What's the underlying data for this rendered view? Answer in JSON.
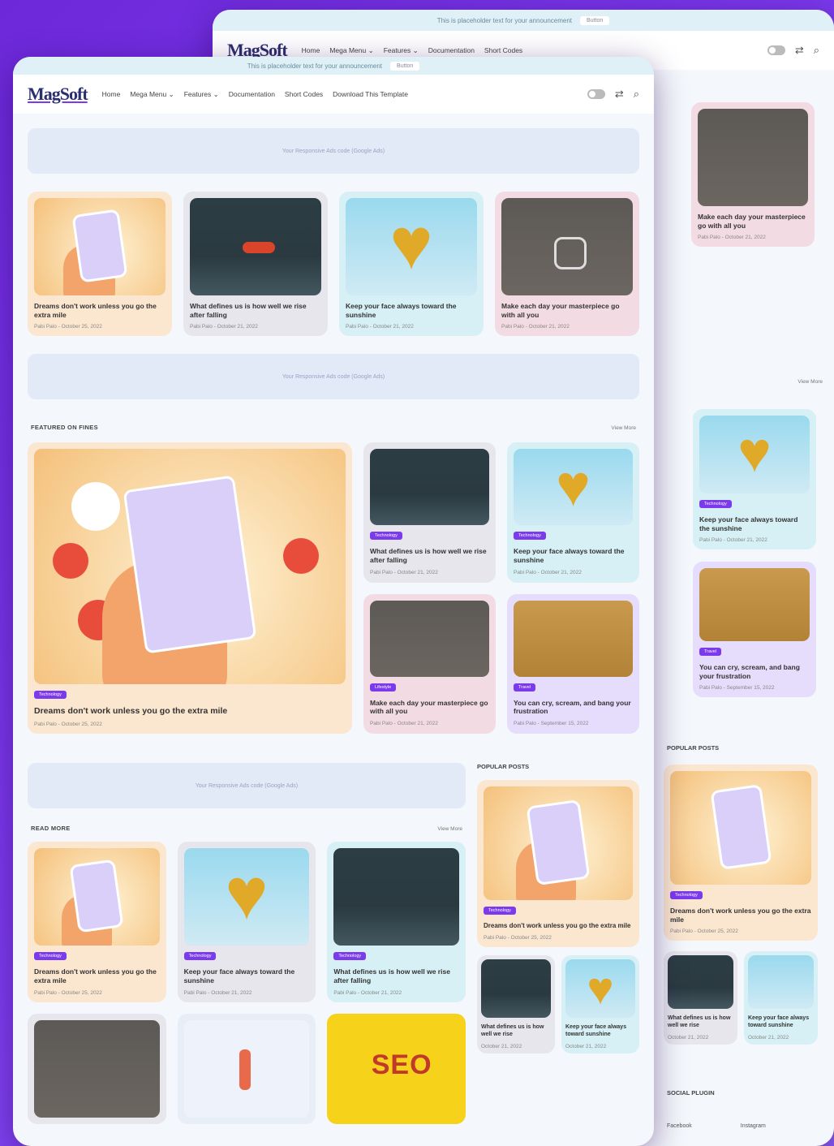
{
  "site": {
    "logo": "MagSoft",
    "topbar_text": "This is placeholder text for your announcement",
    "topbar_button": "Button",
    "nav": [
      "Home",
      "Mega Menu ⌄",
      "Features ⌄",
      "Documentation",
      "Short Codes",
      "Download This Template"
    ],
    "ad_text": "Your Responsive Ads code (Google Ads)"
  },
  "top_cards": [
    {
      "title": "Dreams don't work unless you go the extra mile",
      "meta": "Pabi Palo - October 25, 2022"
    },
    {
      "title": "What defines us is how well we rise after falling",
      "meta": "Pabi Palo - October 21, 2022"
    },
    {
      "title": "Keep your face always toward the sunshine",
      "meta": "Pabi Palo - October 21, 2022"
    },
    {
      "title": "Make each day your masterpiece go with all you",
      "meta": "Pabi Palo - October 21, 2022"
    }
  ],
  "featured": {
    "heading": "FEATURED ON FINES",
    "more": "View More",
    "big": {
      "badge": "Technology",
      "title": "Dreams don't work unless you go the extra mile",
      "meta": "Pabi Palo - October 25, 2022"
    },
    "cards": [
      {
        "badge": "Technology",
        "title": "What defines us is how well we rise after falling",
        "meta": "Pabi Palo - October 21, 2022"
      },
      {
        "badge": "Technology",
        "title": "Keep your face always toward the sunshine",
        "meta": "Pabi Palo - October 21, 2022"
      },
      {
        "badge": "Lifestyle",
        "title": "Make each day your masterpiece go with all you",
        "meta": "Pabi Palo - October 21, 2022"
      },
      {
        "badge": "Travel",
        "title": "You can cry, scream, and bang your frustration",
        "meta": "Pabi Palo - September 15, 2022"
      }
    ]
  },
  "read_more": {
    "heading": "READ MORE",
    "more": "View More",
    "cards": [
      {
        "badge": "Technology",
        "title": "Dreams don't work unless you go the extra mile",
        "meta": "Pabi Palo - October 25, 2022"
      },
      {
        "badge": "Technology",
        "title": "Keep your face always toward the sunshine",
        "meta": "Pabi Palo - October 21, 2022"
      },
      {
        "badge": "Technology",
        "title": "What defines us is how well we rise after falling",
        "meta": "Pabi Palo - October 21, 2022"
      }
    ],
    "bottom_thumb_text": "SEO"
  },
  "popular": {
    "heading": "POPULAR POSTS",
    "main": {
      "badge": "Technology",
      "title": "Dreams don't work unless you go the extra mile",
      "meta": "Pabi Palo - October 25, 2022"
    },
    "minis": [
      {
        "title": "What defines us is how well we rise",
        "meta": "October 21, 2022"
      },
      {
        "title": "Keep your face always toward sunshine",
        "meta": "October 21, 2022"
      }
    ]
  },
  "back_window": {
    "card": {
      "title": "Make each day your masterpiece go with all you",
      "meta": "Pabi Palo - October 21, 2022"
    },
    "more": "View More",
    "cards": [
      {
        "badge": "Technology",
        "title": "Keep your face always toward the sunshine",
        "meta": "Pabi Palo - October 21, 2022"
      },
      {
        "badge": "Travel",
        "title": "You can cry, scream, and bang your frustration",
        "meta": "Pabi Palo - September 15, 2022"
      }
    ],
    "popular_heading": "POPULAR POSTS",
    "popular_main": {
      "badge": "Technology",
      "title": "Dreams don't work unless you go the extra mile",
      "meta": "Pabi Palo - October 25, 2022"
    },
    "popular_minis": [
      {
        "title": "What defines us is how well we rise",
        "meta": "October 21, 2022"
      },
      {
        "title": "Keep your face always toward sunshine",
        "meta": "October 21, 2022"
      }
    ],
    "social_heading": "SOCIAL PLUGIN",
    "social": [
      "Facebook",
      "Instagram"
    ]
  }
}
